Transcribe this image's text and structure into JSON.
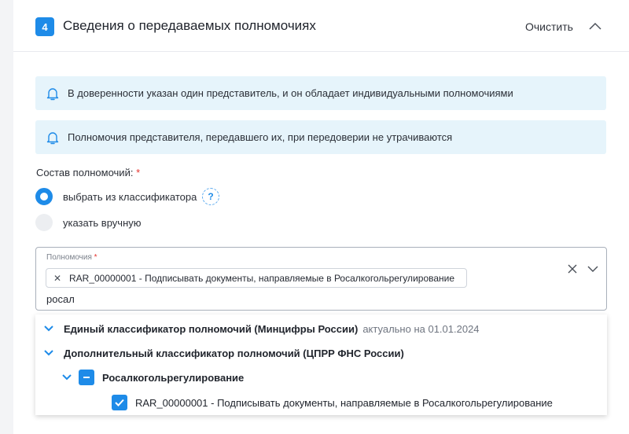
{
  "section": {
    "number": "4",
    "title": "Сведения о передаваемых полномочиях",
    "clear_label": "Очистить"
  },
  "alerts": [
    {
      "text": "В доверенности указан один представитель, и он обладает индивидуальными полномочиями"
    },
    {
      "text": "Полномочия представителя, передавшего их, при передоверии не утрачиваются"
    }
  ],
  "powers": {
    "label": "Состав полномочий:",
    "required_mark": "*",
    "options": [
      {
        "label": "выбрать из классификатора",
        "selected": true,
        "help": "?"
      },
      {
        "label": "указать вручную",
        "selected": false
      }
    ]
  },
  "select": {
    "label": "Полномочия",
    "required_mark": "*",
    "chip_remove": "✕",
    "chip": "RAR_00000001 - Подписывать документы, направляемые в Росалкогольрегулирование",
    "search_value": "росал"
  },
  "tree": [
    {
      "label": "Единый классификатор полномочий (Минцифры России)",
      "note": "актуально на 01.01.2024"
    },
    {
      "label": "Дополнительный классификатор полномочий (ЦПРР ФНС России)"
    },
    {
      "label": "Росалкогольрегулирование"
    },
    {
      "label": "RAR_00000001 - Подписывать документы, направляемые в Росалкогольрегулирование",
      "checked": true
    }
  ],
  "colors": {
    "accent": "#1e8be8",
    "alert_bg": "#e6f4fb",
    "required": "#e5322d"
  }
}
